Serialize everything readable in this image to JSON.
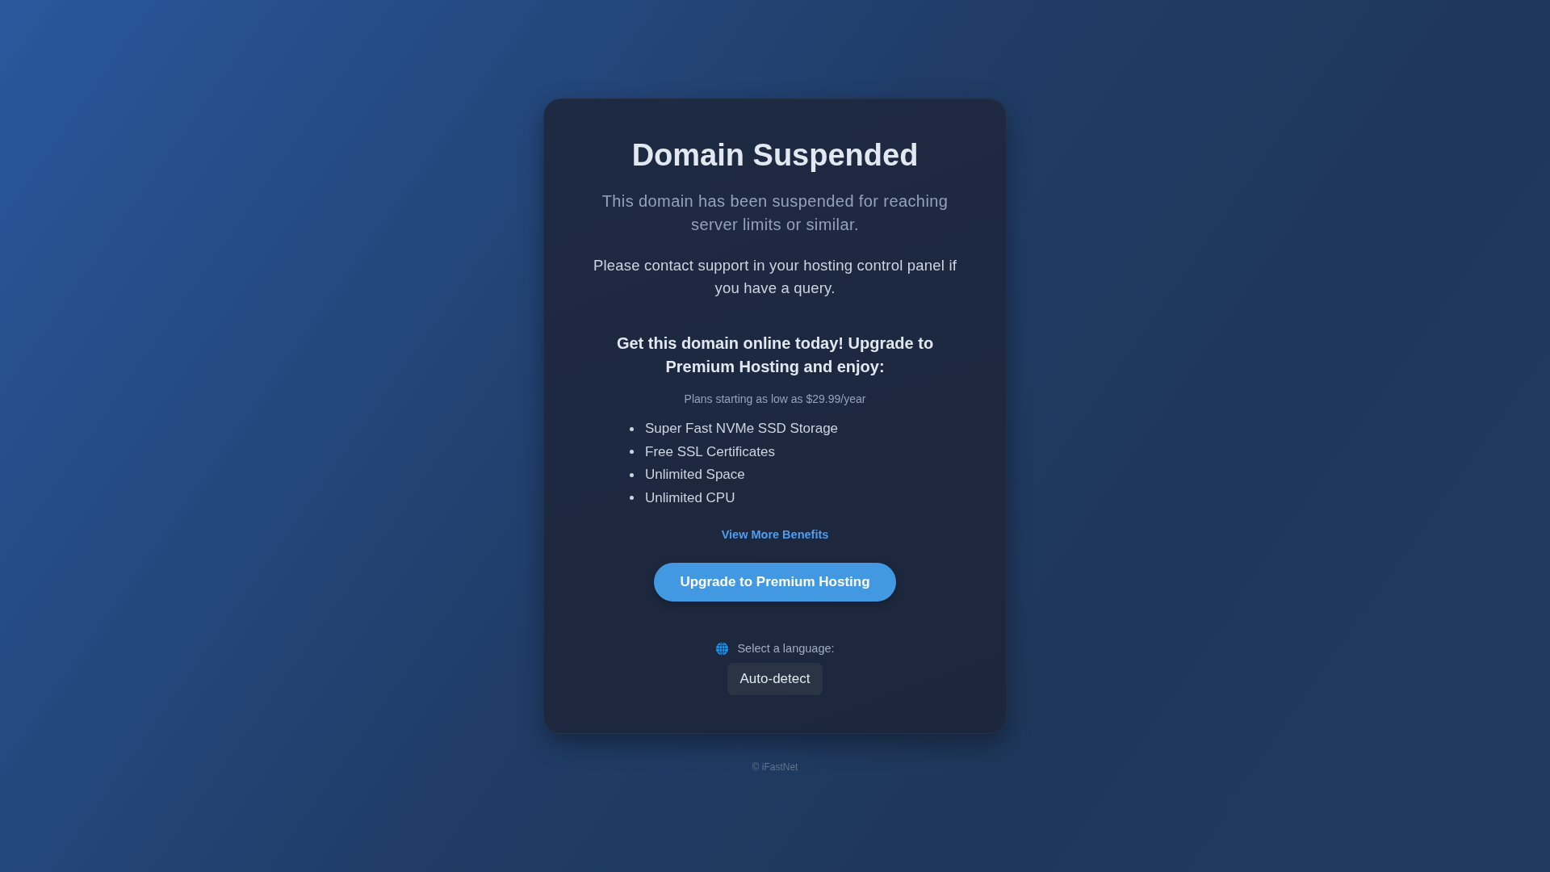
{
  "card": {
    "title": "Domain Suspended",
    "subtitle": "This domain has been suspended for reaching server limits or similar.",
    "message": "Please contact support in your hosting control panel if you have a query.",
    "promo": {
      "heading": "Get this domain online today! Upgrade to Premium Hosting and enjoy:",
      "price_note": "Plans starting as low as $29.99/year",
      "benefits": [
        "Super Fast NVMe SSD Storage",
        "Free SSL Certificates",
        "Unlimited Space",
        "Unlimited CPU"
      ],
      "more_link": "View More Benefits",
      "upgrade_button": "Upgrade to Premium Hosting"
    },
    "language": {
      "label": "Select a language:",
      "value": "Auto-detect"
    }
  },
  "footer": "© iFastNet"
}
